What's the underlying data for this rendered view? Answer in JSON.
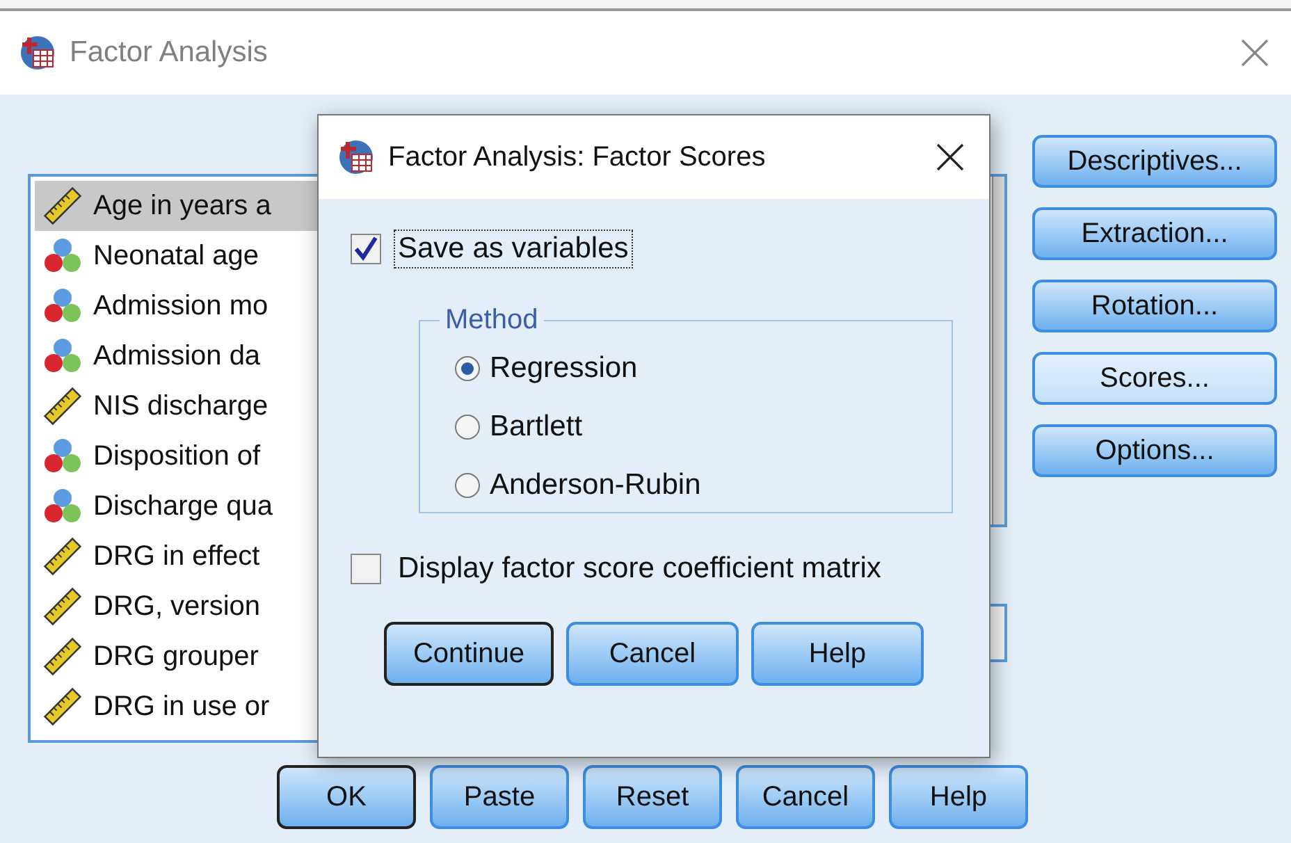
{
  "window": {
    "title": "Factor Analysis"
  },
  "variables": [
    {
      "name": "Age in years a",
      "kind": "scale",
      "selected": true
    },
    {
      "name": "Neonatal age",
      "kind": "nominal",
      "selected": false
    },
    {
      "name": "Admission mo",
      "kind": "nominal",
      "selected": false
    },
    {
      "name": "Admission da",
      "kind": "nominal",
      "selected": false
    },
    {
      "name": "NIS discharge",
      "kind": "scale",
      "selected": false
    },
    {
      "name": "Disposition of",
      "kind": "nominal",
      "selected": false
    },
    {
      "name": "Discharge qua",
      "kind": "nominal",
      "selected": false
    },
    {
      "name": "DRG in effect",
      "kind": "scale",
      "selected": false
    },
    {
      "name": "DRG, version",
      "kind": "scale",
      "selected": false
    },
    {
      "name": "DRG grouper",
      "kind": "scale",
      "selected": false
    },
    {
      "name": "DRG in use or",
      "kind": "scale",
      "selected": false
    }
  ],
  "side_buttons": [
    {
      "label": "Descriptives...",
      "highlighted": false
    },
    {
      "label": "Extraction...",
      "highlighted": false
    },
    {
      "label": "Rotation...",
      "highlighted": false
    },
    {
      "label": "Scores...",
      "highlighted": true
    },
    {
      "label": "Options...",
      "highlighted": false
    }
  ],
  "buttons": [
    {
      "label": "OK",
      "default": true
    },
    {
      "label": "Paste",
      "default": false
    },
    {
      "label": "Reset",
      "default": false
    },
    {
      "label": "Cancel",
      "default": false
    },
    {
      "label": "Help",
      "default": false
    }
  ],
  "dialog": {
    "title": "Factor Analysis: Factor Scores",
    "save_as_variables": {
      "label": "Save as variables",
      "checked": true
    },
    "method": {
      "title": "Method",
      "options": [
        {
          "label": "Regression",
          "selected": true
        },
        {
          "label": "Bartlett",
          "selected": false
        },
        {
          "label": "Anderson-Rubin",
          "selected": false
        }
      ]
    },
    "display_matrix": {
      "label": "Display factor score coefficient matrix",
      "checked": false
    },
    "buttons": [
      {
        "label": "Continue",
        "default": true
      },
      {
        "label": "Cancel",
        "default": false
      },
      {
        "label": "Help",
        "default": false
      }
    ]
  }
}
